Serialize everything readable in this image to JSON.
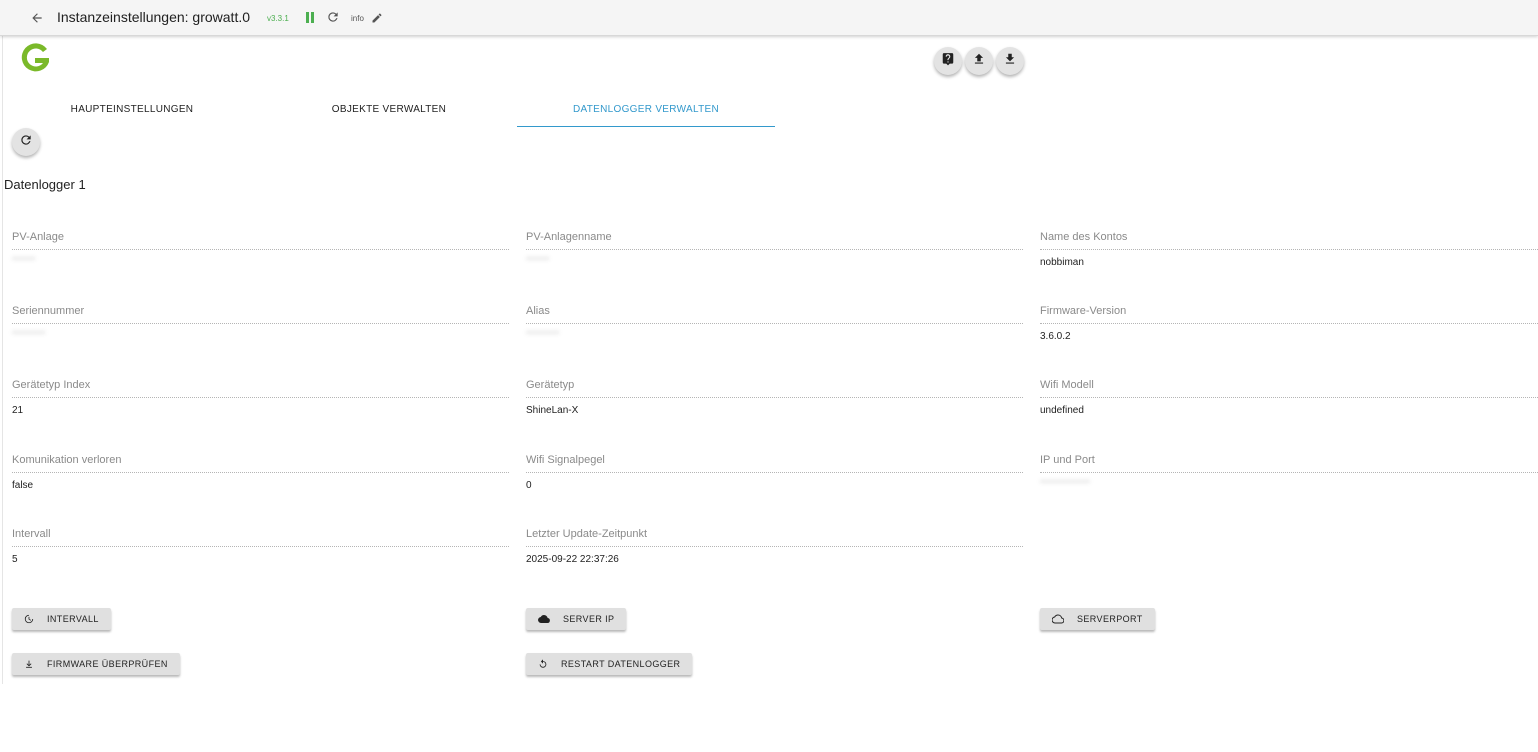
{
  "header": {
    "title": "Instanzeinstellungen: growatt.0",
    "version": "v3.3.1",
    "info": "info"
  },
  "tabs": [
    {
      "label": "HAUPTEINSTELLUNGEN"
    },
    {
      "label": "OBJEKTE VERWALTEN"
    },
    {
      "label": "DATENLOGGER VERWALTEN"
    }
  ],
  "section": {
    "title": "Datenlogger 1"
  },
  "fields": {
    "pv_anlage": {
      "label": "PV-Anlage",
      "value": "·······"
    },
    "pv_anlagenname": {
      "label": "PV-Anlagenname",
      "value": "·······"
    },
    "konto": {
      "label": "Name des Kontos",
      "value": "nobbiman"
    },
    "seriennummer": {
      "label": "Seriennummer",
      "value": "··········"
    },
    "alias": {
      "label": "Alias",
      "value": "··········"
    },
    "firmware": {
      "label": "Firmware-Version",
      "value": "3.6.0.2"
    },
    "geraetetyp_index": {
      "label": "Gerätetyp Index",
      "value": "21"
    },
    "geraetetyp": {
      "label": "Gerätetyp",
      "value": "ShineLan-X"
    },
    "wifi_modell": {
      "label": "Wifi Modell",
      "value": "undefined"
    },
    "kommunikation": {
      "label": "Komunikation verloren",
      "value": "false"
    },
    "wifi_signal": {
      "label": "Wifi Signalpegel",
      "value": "0"
    },
    "ip_port": {
      "label": "IP und Port",
      "value": "···············"
    },
    "intervall": {
      "label": "Intervall",
      "value": "5"
    },
    "letzter_update": {
      "label": "Letzter Update-Zeitpunkt",
      "value": "2025-09-22 22:37:26"
    }
  },
  "buttons": {
    "intervall": "INTERVALL",
    "server_ip": "SERVER IP",
    "serverport": "SERVERPORT",
    "firmware": "FIRMWARE ÜBERPRÜFEN",
    "restart": "RESTART DATENLOGGER"
  },
  "colors": {
    "accent": "#3399cc",
    "version": "#4caf50",
    "logo": "#7ab929"
  }
}
